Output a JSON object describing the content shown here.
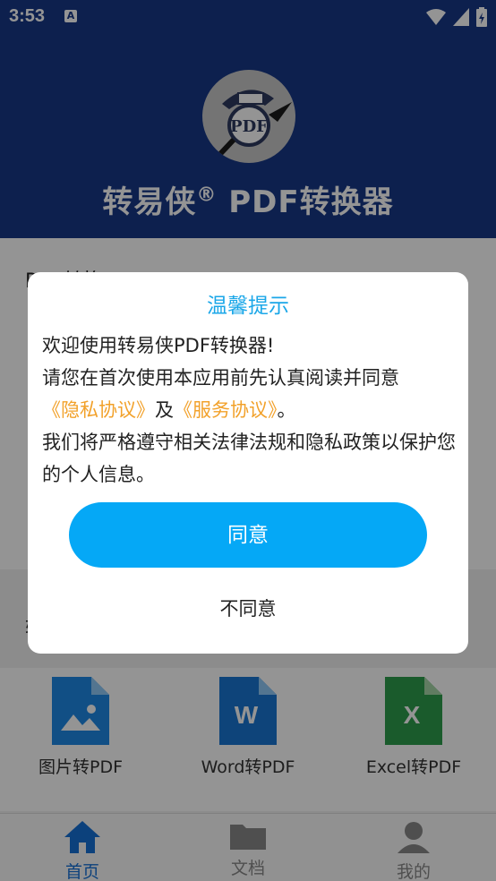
{
  "status": {
    "time": "3:53",
    "notification_letter": "A"
  },
  "header": {
    "app_title_a": "转易侠",
    "app_title_reg": "®",
    "app_title_b": " PDF转换器"
  },
  "content": {
    "section1_title": "PDF转换",
    "section2_title": "转",
    "tools": [
      {
        "label": "图片转PDF",
        "icon": "image-file-icon",
        "color": "#1e88e5"
      },
      {
        "label": "Word转PDF",
        "icon": "word-file-icon",
        "color": "#1976d2"
      },
      {
        "label": "Excel转PDF",
        "icon": "excel-file-icon",
        "color": "#2e9d4c"
      }
    ]
  },
  "tabbar": {
    "tabs": [
      {
        "label": "首页",
        "icon": "home-icon",
        "active": true
      },
      {
        "label": "文档",
        "icon": "folder-icon",
        "active": false
      },
      {
        "label": "我的",
        "icon": "user-icon",
        "active": false
      }
    ]
  },
  "dialog": {
    "title": "温馨提示",
    "line1": "欢迎使用转易侠PDF转换器!",
    "line2": "请您在首次使用本应用前先认真阅读并同意",
    "privacy_link": "《隐私协议》",
    "and": "及",
    "service_link": "《服务协议》",
    "period": "。",
    "line4": "我们将严格遵守相关法律法规和隐私政策以保护您的个人信息。",
    "agree_label": "同意",
    "disagree_label": "不同意"
  },
  "colors": {
    "header_bg": "#173787",
    "accent": "#05a8f6",
    "link": "#f2a12a",
    "title": "#1ba7e8"
  }
}
